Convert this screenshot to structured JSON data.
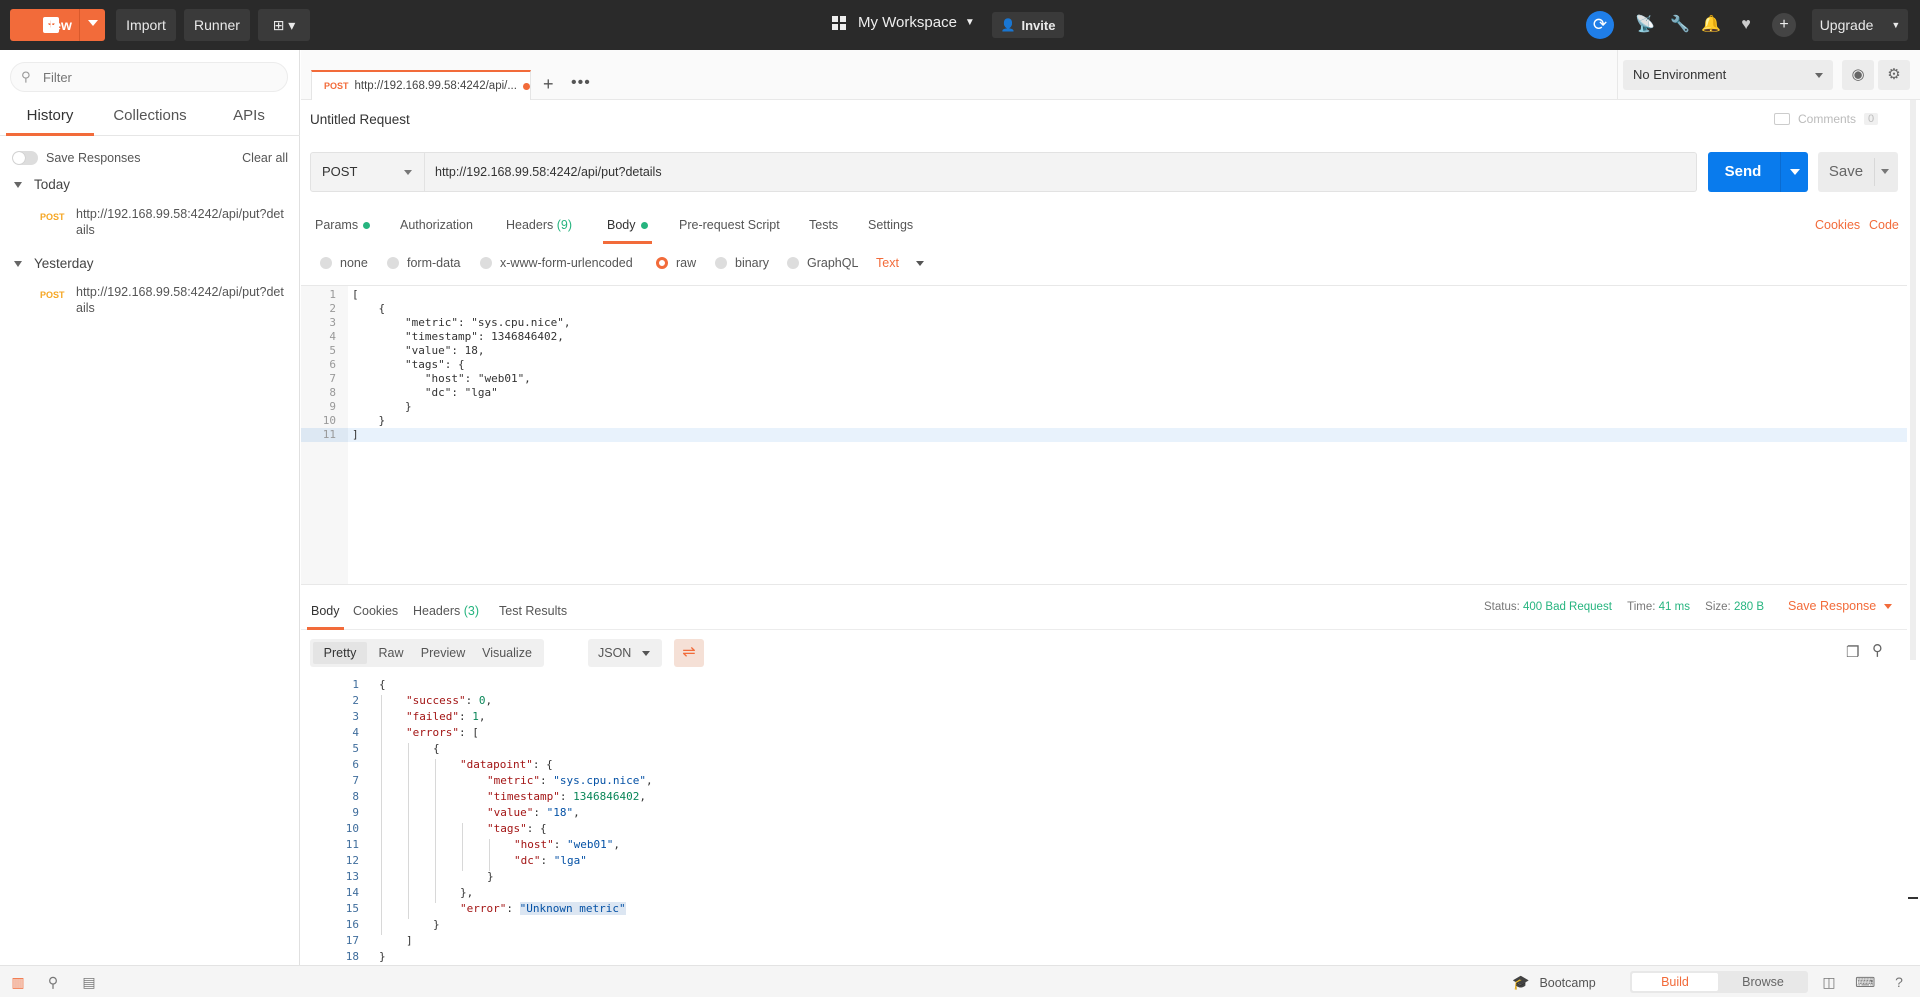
{
  "topbar": {
    "new_label": "New",
    "import_label": "Import",
    "runner_label": "Runner",
    "workspace_label": "My Workspace",
    "invite_label": "Invite",
    "upgrade_label": "Upgrade"
  },
  "sidebar": {
    "filter_placeholder": "Filter",
    "tabs": [
      "History",
      "Collections",
      "APIs"
    ],
    "save_responses_label": "Save Responses",
    "clear_all_label": "Clear all",
    "groups": [
      {
        "label": "Today",
        "items": [
          {
            "method": "POST",
            "url": "http://192.168.99.58:4242/api/put?details"
          }
        ]
      },
      {
        "label": "Yesterday",
        "items": [
          {
            "method": "POST",
            "url": "http://192.168.99.58:4242/api/put?details"
          }
        ]
      }
    ]
  },
  "request_tab": {
    "method": "POST",
    "url_short": "http://192.168.99.58:4242/api/..."
  },
  "environment": {
    "selected": "No Environment"
  },
  "request": {
    "title": "Untitled Request",
    "comments_label": "Comments",
    "comments_count": "0",
    "method": "POST",
    "url": "http://192.168.99.58:4242/api/put?details",
    "send_label": "Send",
    "save_label": "Save",
    "tabs": {
      "params": "Params",
      "authorization": "Authorization",
      "headers": "Headers",
      "headers_count": "(9)",
      "body": "Body",
      "prerequest": "Pre-request Script",
      "tests": "Tests",
      "settings": "Settings"
    },
    "cookies_label": "Cookies",
    "code_label": "Code",
    "body_types": [
      "none",
      "form-data",
      "x-www-form-urlencoded",
      "raw",
      "binary",
      "GraphQL"
    ],
    "selected_body_type": "raw",
    "raw_format": "Text",
    "body_lines": [
      "[",
      "    {",
      "        \"metric\": \"sys.cpu.nice\",",
      "        \"timestamp\": 1346846402,",
      "        \"value\": 18,",
      "        \"tags\": {",
      "           \"host\": \"web01\",",
      "           \"dc\": \"lga\"",
      "        }",
      "    }",
      "]"
    ]
  },
  "response": {
    "tabs": {
      "body": "Body",
      "cookies": "Cookies",
      "headers": "Headers",
      "headers_count": "(3)",
      "test_results": "Test Results"
    },
    "status_label": "Status:",
    "status_value": "400 Bad Request",
    "time_label": "Time:",
    "time_value": "41 ms",
    "size_label": "Size:",
    "size_value": "280 B",
    "save_response_label": "Save Response",
    "view_modes": [
      "Pretty",
      "Raw",
      "Preview",
      "Visualize"
    ],
    "format": "JSON",
    "body_lines": [
      {
        "indent": 0,
        "parts": [
          [
            "p",
            "{"
          ]
        ]
      },
      {
        "indent": 1,
        "parts": [
          [
            "k",
            "\"success\""
          ],
          [
            "p",
            ": "
          ],
          [
            "n",
            "0"
          ],
          [
            "p",
            ","
          ]
        ]
      },
      {
        "indent": 1,
        "parts": [
          [
            "k",
            "\"failed\""
          ],
          [
            "p",
            ": "
          ],
          [
            "n",
            "1"
          ],
          [
            "p",
            ","
          ]
        ]
      },
      {
        "indent": 1,
        "parts": [
          [
            "k",
            "\"errors\""
          ],
          [
            "p",
            ": ["
          ]
        ]
      },
      {
        "indent": 2,
        "parts": [
          [
            "p",
            "{"
          ]
        ]
      },
      {
        "indent": 3,
        "parts": [
          [
            "k",
            "\"datapoint\""
          ],
          [
            "p",
            ": {"
          ]
        ]
      },
      {
        "indent": 4,
        "parts": [
          [
            "k",
            "\"metric\""
          ],
          [
            "p",
            ": "
          ],
          [
            "s",
            "\"sys.cpu.nice\""
          ],
          [
            "p",
            ","
          ]
        ]
      },
      {
        "indent": 4,
        "parts": [
          [
            "k",
            "\"timestamp\""
          ],
          [
            "p",
            ": "
          ],
          [
            "n",
            "1346846402"
          ],
          [
            "p",
            ","
          ]
        ]
      },
      {
        "indent": 4,
        "parts": [
          [
            "k",
            "\"value\""
          ],
          [
            "p",
            ": "
          ],
          [
            "s",
            "\"18\""
          ],
          [
            "p",
            ","
          ]
        ]
      },
      {
        "indent": 4,
        "parts": [
          [
            "k",
            "\"tags\""
          ],
          [
            "p",
            ": {"
          ]
        ]
      },
      {
        "indent": 5,
        "parts": [
          [
            "k",
            "\"host\""
          ],
          [
            "p",
            ": "
          ],
          [
            "s",
            "\"web01\""
          ],
          [
            "p",
            ","
          ]
        ]
      },
      {
        "indent": 5,
        "parts": [
          [
            "k",
            "\"dc\""
          ],
          [
            "p",
            ": "
          ],
          [
            "s",
            "\"lga\""
          ]
        ]
      },
      {
        "indent": 4,
        "parts": [
          [
            "p",
            "}"
          ]
        ]
      },
      {
        "indent": 3,
        "parts": [
          [
            "p",
            "},"
          ]
        ]
      },
      {
        "indent": 3,
        "parts": [
          [
            "k",
            "\"error\""
          ],
          [
            "p",
            ": "
          ],
          [
            "s",
            "\"Unknown metric\""
          ]
        ]
      },
      {
        "indent": 2,
        "parts": [
          [
            "p",
            "}"
          ]
        ]
      },
      {
        "indent": 1,
        "parts": [
          [
            "p",
            "]"
          ]
        ]
      },
      {
        "indent": 0,
        "parts": [
          [
            "p",
            "}"
          ]
        ]
      }
    ]
  },
  "statusbar": {
    "bootcamp_label": "Bootcamp",
    "build_label": "Build",
    "browse_label": "Browse"
  },
  "colors": {
    "accent": "#f26b3a",
    "send_blue": "#097bed",
    "success_green": "#26b47f",
    "topbar_bg": "#2a2a2a"
  },
  "icons": [
    "plus-icon",
    "new-window-icon",
    "workspace-grid-icon",
    "invite-user-icon",
    "sync-icon",
    "satellite-icon",
    "wrench-icon",
    "bell-icon",
    "heart-icon",
    "add-circle-icon",
    "search-icon",
    "eye-icon",
    "gear-icon",
    "comments-icon",
    "wrap-lines-icon",
    "copy-icon",
    "magnifier-icon",
    "sidebar-toggle-icon",
    "find-icon",
    "console-icon",
    "bootcamp-icon",
    "two-pane-icon",
    "keyboard-icon",
    "help-icon"
  ]
}
